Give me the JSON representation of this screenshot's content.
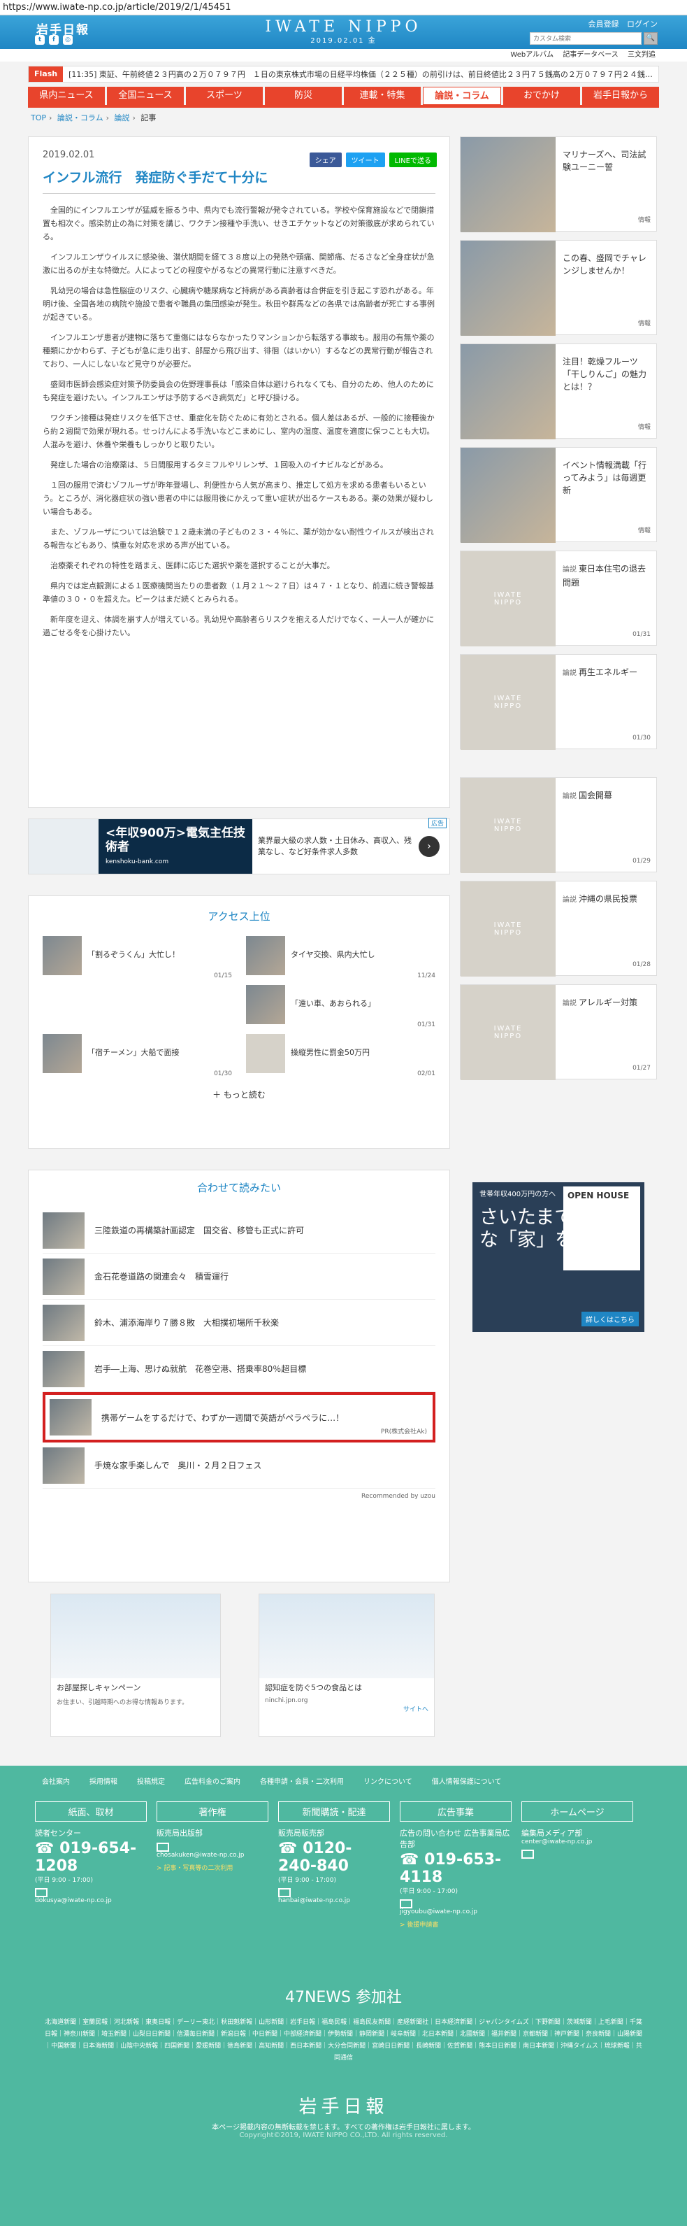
{
  "url": "https://www.iwate-np.co.jp/article/2019/2/1/45451",
  "header": {
    "small_logo": "岩手日報",
    "center_logo": "IWATE NIPPO",
    "date": "2019.02.01 金",
    "links": [
      "会員登録",
      "ログイン"
    ],
    "search_placeholder": "カスタム検索"
  },
  "subnav": [
    "Webアルバム",
    "記事データベース",
    "三文判追"
  ],
  "flash": {
    "tag": "Flash",
    "text": "[11:35] 東証、午前終値２３円高の２万０７９７円　１日の東京株式市場の日経平均株価（２２５種）の前引けは、前日終値比２３円７５銭高の２万０７９７円２４銭…"
  },
  "mainnav": [
    "県内ニュース",
    "全国ニュース",
    "スポーツ",
    "防災",
    "連載・特集",
    "論説・コラム",
    "おでかけ",
    "岩手日報から"
  ],
  "breadcrumb": [
    "TOP",
    "論説・コラム",
    "論説",
    "記事"
  ],
  "article": {
    "date": "2019.02.01",
    "share": [
      "シェア",
      "ツイート",
      "LINEで送る"
    ],
    "title": "インフル流行　発症防ぐ手だて十分に",
    "paragraphs": [
      "全国的にインフルエンザが猛威を振るう中、県内でも流行警報が発令されている。学校や保育施設などで閉鎖措置も相次ぐ。感染防止の為に対策を講じ、ワクチン接種や手洗い、せきエチケットなどの対策徹底が求められている。",
      "インフルエンザウイルスに感染後、潜伏期間を経て３８度以上の発熱や頭痛、関節痛、だるさなど全身症状が急激に出るのが主な特徴だ。人によってどの程度やがるなどの異常行動に注意すべきだ。",
      "乳幼児の場合は急性脳症のリスク、心臓病や糖尿病など持病がある高齢者は合併症を引き起こす恐れがある。年明け後、全国各地の病院や施設で患者や職員の集団感染が発生。秋田や群馬などの各県では高齢者が死亡する事例が起きている。",
      "インフルエンザ患者が建物に落ちて重傷にはならなかったりマンションから転落する事故も。服用の有無や薬の種類にかかわらず、子どもが急に走り出す、部屋から飛び出す、徘徊（はいかい）するなどの異常行動が報告されており、一人にしないなど見守りが必要だ。",
      "盛岡市医師会感染症対策予防委員会の佐野理事長は「感染自体は避けられなくても、自分のため、他人のためにも発症を避けたい。インフルエンザは予防するべき病気だ」と呼び掛ける。",
      "ワクチン接種は発症リスクを低下させ、重症化を防ぐために有効とされる。個人差はあるが、一般的に接種後から約２週間で効果が現れる。せっけんによる手洗いなどこまめにし、室内の湿度、温度を適度に保つことも大切。人混みを避け、休養や栄養もしっかりと取りたい。",
      "発症した場合の治療薬は、５日間服用するタミフルやリレンザ、１回吸入のイナビルなどがある。",
      "１回の服用で済むゾフルーザが昨年登場し、利便性から人気が高まり、推定して処方を求める患者もいるという。ところが、消化器症状の強い患者の中には服用後にかえって重い症状が出るケースもある。薬の効果が疑わしい場合もある。",
      "また、ゾフルーザについては治験で１２歳未満の子どもの２３・４％に、薬が効かない耐性ウイルスが検出される報告などもあり、慎重な対応を求める声が出ている。",
      "治療薬それぞれの特性を踏まえ、医師に応じた選択や薬を選択することが大事だ。",
      "県内では定点観測による１医療機関当たりの患者数（１月２１～２７日）は４７・１となり、前週に続き警報基準値の３０・０を超えた。ピークはまだ続くとみられる。",
      "新年度を迎え、体調を崩す人が増えている。乳幼児や高齢者らリスクを抱える人だけでなく、一人一人が確かに過ごせる冬を心掛けたい。"
    ]
  },
  "sidebar": [
    {
      "cat": "",
      "title": "マリナーズへ、司法試験ユーニー誓",
      "date": "",
      "tag": "情報"
    },
    {
      "cat": "",
      "title": "この春、盛岡でチャレンジしませんか！",
      "date": "",
      "tag": "情報"
    },
    {
      "cat": "",
      "title": "注目！乾燥フルーツ「干しりんご」の魅力とは！？",
      "date": "",
      "tag": "情報"
    },
    {
      "cat": "",
      "title": "イベント情報満載「行ってみよう」は毎週更新",
      "date": "",
      "tag": "情報"
    },
    {
      "cat": "論説",
      "title": "東日本住宅の退去問題",
      "date": "01/31"
    },
    {
      "cat": "論説",
      "title": "再生エネルギー",
      "date": "01/30"
    },
    {
      "cat": "論説",
      "title": "国会開幕",
      "date": "01/29"
    },
    {
      "cat": "論説",
      "title": "沖縄の県民投票",
      "date": "01/28"
    },
    {
      "cat": "論説",
      "title": "アレルギー対策",
      "date": "01/27"
    }
  ],
  "ad_banner": {
    "head": "<年収900万>電気主任技術者",
    "site": "kenshoku-bank.com",
    "text": "業界最大級の求人数・土日休み、高収入、残業なし、など好条件求人多数",
    "tag": "広告"
  },
  "access": {
    "title": "アクセス上位",
    "items": [
      {
        "title": "「割るぞうくん」大忙し！",
        "date": "01/15"
      },
      {
        "title": "タイヤ交換、県内大忙し",
        "date": "11/24"
      },
      {
        "title": "",
        "date": ""
      },
      {
        "title": "「遠い車、あおられる」",
        "date": "01/31"
      },
      {
        "title": "「宿チーメン」大船で面接",
        "date": "01/30"
      },
      {
        "title": "操縦男性に罰金50万円",
        "date": "02/01"
      }
    ],
    "more": "もっと読む"
  },
  "related": {
    "title": "合わせて読みたい",
    "items": [
      {
        "title": "三陸鉄道の再構築計画認定　国交省、移管も正式に許可",
        "pr": ""
      },
      {
        "title": "金石花巻道路の関連会々　積雪運行",
        "pr": ""
      },
      {
        "title": "鈴木、浦添海岸り７勝８敗　大相撲初場所千秋楽",
        "pr": ""
      },
      {
        "title": "岩手―上海、思けぬ就航　花巻空港、搭乗率80％超目標",
        "pr": ""
      },
      {
        "title": "携帯ゲームをするだけで、わずか一週間で英語がペラペラに…！",
        "pr": "PR(株式会社Ak)"
      },
      {
        "title": "手焼な家手楽しんで　奥川・２月２日フェス",
        "pr": ""
      }
    ],
    "powered": "Recommended by uzou"
  },
  "ad_box1": {
    "cap": "お部屋探しキャンペーン",
    "small": "お住まい、引越時期へのお得な情報あります。",
    "tag": "広告"
  },
  "ad_box2": {
    "cap": "認知症を防ぐ5つの食品とは",
    "small": "ninchi.jpn.org",
    "link": "サイトへ"
  },
  "side_ad": {
    "t1": "世帯年収400万円の方へ",
    "t2": "さいたまで理想的な「家」を。",
    "t3": "OPEN HOUSE",
    "t4": "詳しくはこちら"
  },
  "footer": {
    "links": [
      "会社案内",
      "採用情報",
      "投稿規定",
      "広告料金のご案内",
      "各種申請・会員・二次利用",
      "リンクについて",
      "個人情報保護について"
    ],
    "boxes": [
      {
        "head": "紙面、取材",
        "sub": "読者センター",
        "tel": "019-654-1208",
        "hours": "(平日 9:00 - 17:00)",
        "mail": "dokusya@iwate-np.co.jp",
        "note": ""
      },
      {
        "head": "著作権",
        "sub": "販売局出版部",
        "tel": "",
        "hours": "",
        "mail": "chosakuken@iwate-np.co.jp",
        "note": "> 記事・写真等の二次利用"
      },
      {
        "head": "新聞購読・配達",
        "sub": "販売局販売部",
        "tel": "0120-240-840",
        "hours": "(平日 9:00 - 17:00)",
        "mail": "hanbai@iwate-np.co.jp",
        "note": ""
      },
      {
        "head": "広告事業",
        "sub": "広告の問い合わせ 広告事業局広告部",
        "tel": "019-653-4118",
        "hours": "(平日 9:00 - 17:00)",
        "mail": "jigyoubu@iwate-np.co.jp",
        "note": "> 後援申請書"
      },
      {
        "head": "ホームページ",
        "sub": "編集局メディア部",
        "tel": "",
        "hours": "",
        "mail": "center@iwate-np.co.jp",
        "note": ""
      }
    ],
    "news47": "47NEWS 参加社",
    "list": "北海道新聞｜室蘭民報｜河北新報｜東奥日報｜デーリー東北｜秋田魁新報｜山形新聞｜岩手日報｜福島民報｜福島民友新聞｜産経新聞社｜日本経済新聞｜ジャパンタイムズ｜下野新聞｜茨城新聞｜上毛新聞｜千葉日報｜神奈川新聞｜埼玉新聞｜山梨日日新聞｜信濃毎日新聞｜新潟日報｜中日新聞｜中部経済新聞｜伊勢新聞｜静岡新聞｜岐阜新聞｜北日本新聞｜北國新聞｜福井新聞｜京都新聞｜神戸新聞｜奈良新聞｜山陽新聞｜中国新聞｜日本海新聞｜山陰中央新報｜四国新聞｜愛媛新聞｜徳島新聞｜高知新聞｜西日本新聞｜大分合同新聞｜宮崎日日新聞｜長崎新聞｜佐賀新聞｜熊本日日新聞｜南日本新聞｜沖縄タイムス｜琉球新報｜共同通信",
    "logo": "岩手日報",
    "copy": "本ページ掲載内容の無断転載を禁じます。すべての著作権は岩手日報社に属します。",
    "copyright": "Copyright©2019, IWATE NIPPO CO.,LTD. All rights reserved."
  }
}
